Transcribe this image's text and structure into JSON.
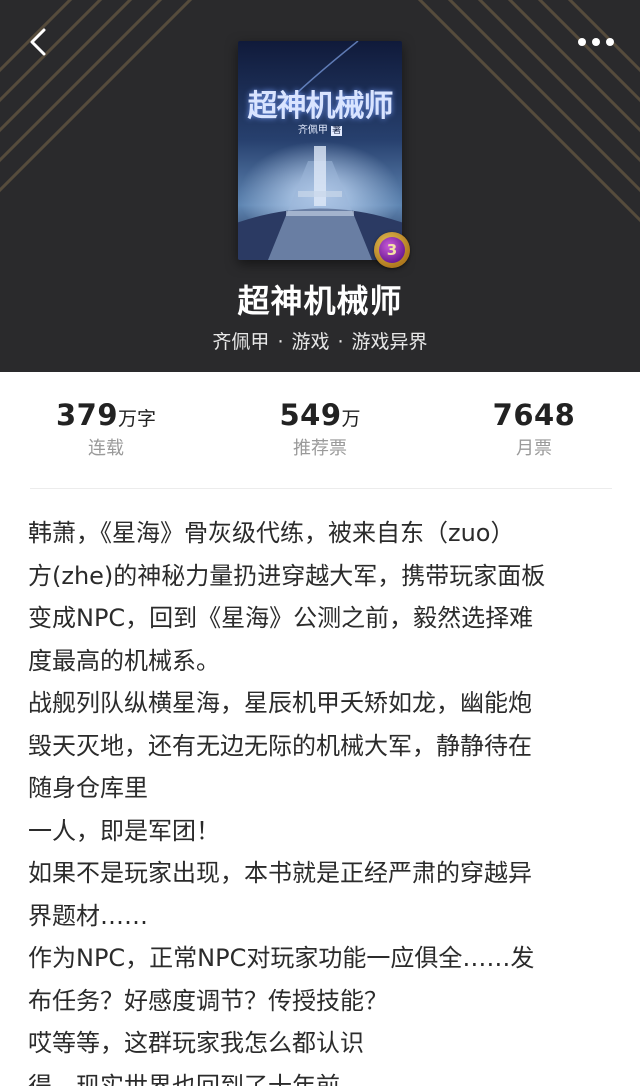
{
  "header": {
    "book_title": "超神机械师",
    "author": "齐佩甲",
    "category": "游戏",
    "subcategory": "游戏异界",
    "separator": "·",
    "level_badge": "3"
  },
  "cover": {
    "title": "超神机械师",
    "author": "齐佩甲",
    "author_tag": "著"
  },
  "stats": [
    {
      "number": "379",
      "unit": "万字",
      "label": "连载"
    },
    {
      "number": "549",
      "unit": "万",
      "label": "推荐票"
    },
    {
      "number": "7648",
      "unit": "",
      "label": "月票"
    }
  ],
  "description": {
    "lines": [
      "韩萧，《星海》骨灰级代练，被来自东（zuo）",
      "方(zhe)的神秘力量扔进穿越大军，携带玩家面板",
      "变成NPC，回到《星海》公测之前，毅然选择难",
      "度最高的机械系。",
      "战舰列队纵横星海，星辰机甲夭矫如龙，幽能炮",
      "毁天灭地，还有无边无际的机械大军，静静待在",
      "随身仓库里",
      "一人，即是军团！",
      "如果不是玩家出现，本书就是正经严肃的穿越异",
      "界题材……",
      "作为NPC，正常NPC对玩家功能一应俱全……发",
      "布任务？好感度调节？传授技能？",
      "哎等等，这群玩家我怎么都认识",
      "得，现实世界也回到了十年前。"
    ]
  },
  "icons": {
    "back": "back-arrow-icon",
    "more": "more-dots-icon"
  },
  "colors": {
    "header_bg": "#2a2a2c",
    "stripe": "#b8945a",
    "text": "#2b2b2b",
    "label": "#9a9a9a"
  }
}
